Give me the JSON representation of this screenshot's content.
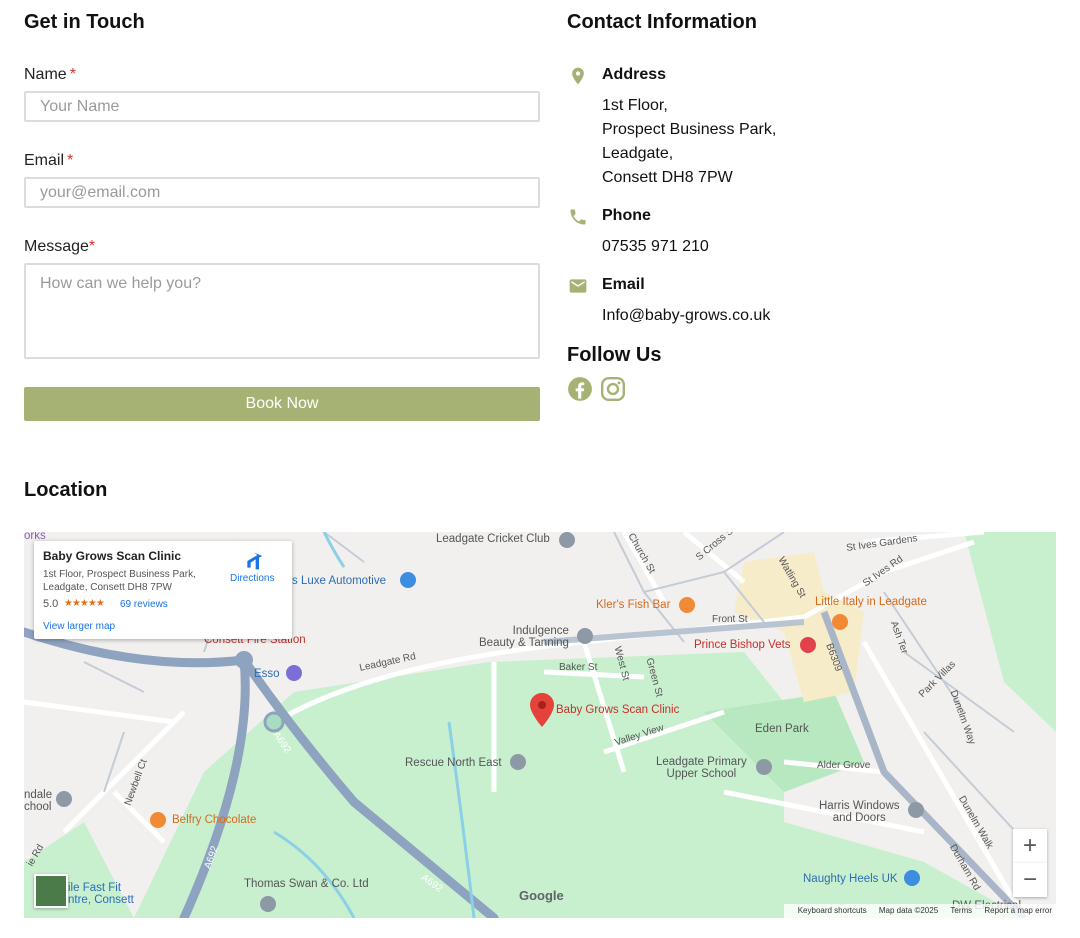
{
  "form": {
    "heading": "Get in Touch",
    "name_label": "Name",
    "name_placeholder": "Your Name",
    "email_label": "Email",
    "email_placeholder": "your@email.com",
    "message_label": "Message",
    "message_placeholder": "How can we help you?",
    "required_mark": "*",
    "submit_label": "Book Now"
  },
  "contact": {
    "heading": "Contact Information",
    "address_title": "Address",
    "address_lines": [
      "1st Floor,",
      "Prospect Business Park,",
      "Leadgate,",
      "Consett DH8 7PW"
    ],
    "phone_title": "Phone",
    "phone": "07535 971 210",
    "email_title": "Email",
    "email": "Info@baby-grows.co.uk",
    "follow_heading": "Follow Us",
    "icon_color": "#a5b274"
  },
  "location": {
    "heading": "Location"
  },
  "map": {
    "card": {
      "name": "Baby Grows Scan Clinic",
      "address": "1st Floor, Prospect Business Park, Leadgate, Consett DH8 7PW",
      "rating": "5.0",
      "stars": "★★★★★",
      "reviews": "69 reviews",
      "directions": "Directions",
      "larger_map": "View larger map"
    },
    "labels": {
      "cricket": "Leadgate Cricket Club",
      "luxe": "s Luxe Automotive",
      "fire": "Consett Fire Station",
      "esso": "Esso",
      "leadgate_rd": "Leadgate Rd",
      "indulgence": "Indulgence\nBeauty & Tanning",
      "baker": "Baker St",
      "west": "West St",
      "green": "Green St",
      "front": "Front St",
      "church": "Church St",
      "scross": "S Cross St",
      "watling": "Watling St",
      "stives_gardens": "St Ives Gardens",
      "stives_rd": "St Ives Rd",
      "kler": "Kler's Fish Bar",
      "little_italy": "Little Italy in Leadgate",
      "prince": "Prince Bishop Vets",
      "b6309": "B6309",
      "ash": "Ash Ter",
      "park_villas": "Park Villas",
      "dunelm_way": "Dunelm Way",
      "clinic": "Baby Grows Scan Clinic",
      "valley": "Valley View",
      "eden": "Eden Park",
      "rescue": "Rescue North East",
      "primary": "Leadgate Primary\nUpper School",
      "alder": "Alder Grove",
      "harris": "Harris Windows\nand Doors",
      "dunelm_walk": "Dunelm Walk",
      "durham": "Durham Rd",
      "a692a": "A692",
      "a692b": "A692",
      "a692c": "A692",
      "newbell": "Newbell Ct",
      "belfry": "Belfry Chocolate",
      "ndale": "ndale\nchool",
      "ierd": "ie Rd",
      "thomas": "Thomas Swan & Co. Ltd",
      "naughty": "Naughty Heels UK",
      "fastfit": "ile Fast Fit\nntre, Consett",
      "works": "orks",
      "dw": "DW Electrical"
    },
    "google": "Google",
    "zoom_in": "+",
    "zoom_out": "−",
    "attribution": [
      "Keyboard shortcuts",
      "Map data ©2025",
      "Terms",
      "Report a map error"
    ]
  }
}
